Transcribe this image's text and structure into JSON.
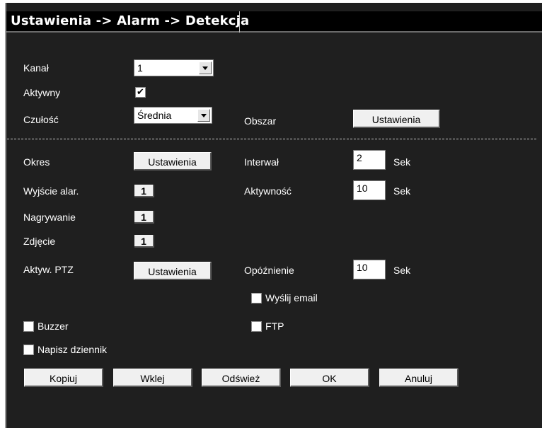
{
  "title": "Ustawienia -> Alarm -> Detekcja",
  "kanal": {
    "label": "Kanał",
    "value": "1"
  },
  "aktywny": {
    "label": "Aktywny",
    "checked": true
  },
  "czulosc": {
    "label": "Czułość",
    "value": "Średnia"
  },
  "obszar": {
    "label": "Obszar",
    "button": "Ustawienia"
  },
  "okres": {
    "label": "Okres",
    "button": "Ustawienia"
  },
  "interwal": {
    "label": "Interwał",
    "value": "2",
    "unit": "Sek"
  },
  "wyjscie": {
    "label": "Wyjście alar.",
    "value": "1"
  },
  "aktywnosc": {
    "label": "Aktywność",
    "value": "10",
    "unit": "Sek"
  },
  "nagrywanie": {
    "label": "Nagrywanie",
    "value": "1"
  },
  "zdjecie": {
    "label": "Zdjęcie",
    "value": "1"
  },
  "ptz": {
    "label": "Aktyw. PTZ",
    "button": "Ustawienia"
  },
  "opoznienie": {
    "label": "Opóźnienie",
    "value": "10",
    "unit": "Sek"
  },
  "email": {
    "label": "Wyślij email",
    "checked": false
  },
  "buzzer": {
    "label": "Buzzer",
    "checked": false
  },
  "ftp": {
    "label": "FTP",
    "checked": false
  },
  "dziennik": {
    "label": "Napisz dziennik",
    "checked": false
  },
  "footer": {
    "kopiuj": "Kopiuj",
    "wklej": "Wklej",
    "odswiez": "Odśwież",
    "ok": "OK",
    "anuluj": "Anuluj"
  }
}
